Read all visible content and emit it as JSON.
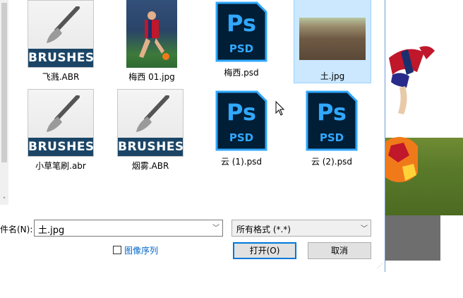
{
  "files": [
    {
      "name": "飞溅.ABR",
      "type": "brushes"
    },
    {
      "name": "梅西 01.jpg",
      "type": "photo"
    },
    {
      "name": "梅西.psd",
      "type": "psd"
    },
    {
      "name": "土.jpg",
      "type": "soil",
      "selected": true
    },
    {
      "name": "小草笔刷.abr",
      "type": "brushes"
    },
    {
      "name": "烟雾.ABR",
      "type": "brushes"
    },
    {
      "name": "云 (1).psd",
      "type": "psd"
    },
    {
      "name": "云 (2).psd",
      "type": "psd"
    }
  ],
  "brush_band_text": "BRUSHES",
  "psd_letters": "Ps",
  "psd_tag": "PSD",
  "filename_label": "件名(N):",
  "filename_value": "土.jpg",
  "filetype_value": "所有格式 (*.*)",
  "image_sequence_label": "图像序列",
  "open_button": "打开(O)",
  "cancel_button": "取消",
  "colors": {
    "ps_blue": "#31a8ff",
    "ps_dark": "#001e36",
    "selection": "#cce8ff",
    "brush_band": "#1b4566"
  }
}
